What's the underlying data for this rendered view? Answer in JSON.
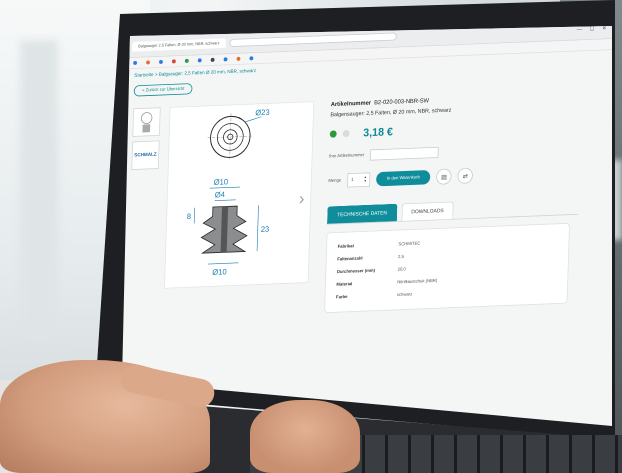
{
  "browser": {
    "tab_title": "Balgsauger 2,5 Falten, Ø 20 mm, NBR, schwarz",
    "url": "",
    "controls": "— ☐ ✕",
    "bookmarks": [
      "",
      "",
      "",
      "",
      "",
      "",
      "",
      "",
      "",
      ""
    ]
  },
  "page": {
    "breadcrumb": "Startseite > Balgsauger: 2,5 Falten Ø 20 mm, NBR, schwarz",
    "back_label": "« Zurück zur Übersicht",
    "brand_logo": "SCHMALZ"
  },
  "drawing": {
    "dim_d23": "Ø23",
    "dim_d10_top": "Ø10",
    "dim_d4": "Ø4",
    "dim_8": "8",
    "dim_23": "23",
    "dim_d10_bottom": "Ø10"
  },
  "product": {
    "article_label": "Artikelnummer",
    "article_number": "B2-020-003-NBR-SW",
    "description": "Balgensauger: 2,5 Falten, Ø 20 mm, NBR, schwarz",
    "price": "3,18 €",
    "own_article_label": "Ihre Artikelnummer",
    "qty_label": "Menge",
    "qty_value": "1",
    "cart_label": "In den Warenkorb",
    "stock_color": "#2b9a3a"
  },
  "tabs": [
    {
      "label": "TECHNISCHE DATEN",
      "active": true
    },
    {
      "label": "DOWNLOADS",
      "active": false
    }
  ],
  "specs": [
    {
      "key": "Fabrikat",
      "value": "SCHMITEC"
    },
    {
      "key": "Faltenanzahl",
      "value": "2,5"
    },
    {
      "key": "Durchmesser (mm)",
      "value": "20,0"
    },
    {
      "key": "Material",
      "value": "Nitrilkautschuk (NBR)"
    },
    {
      "key": "Farbe",
      "value": "schwarz"
    }
  ],
  "colors": {
    "accent": "#0f8d9a",
    "dimension": "#1c7fb5"
  }
}
